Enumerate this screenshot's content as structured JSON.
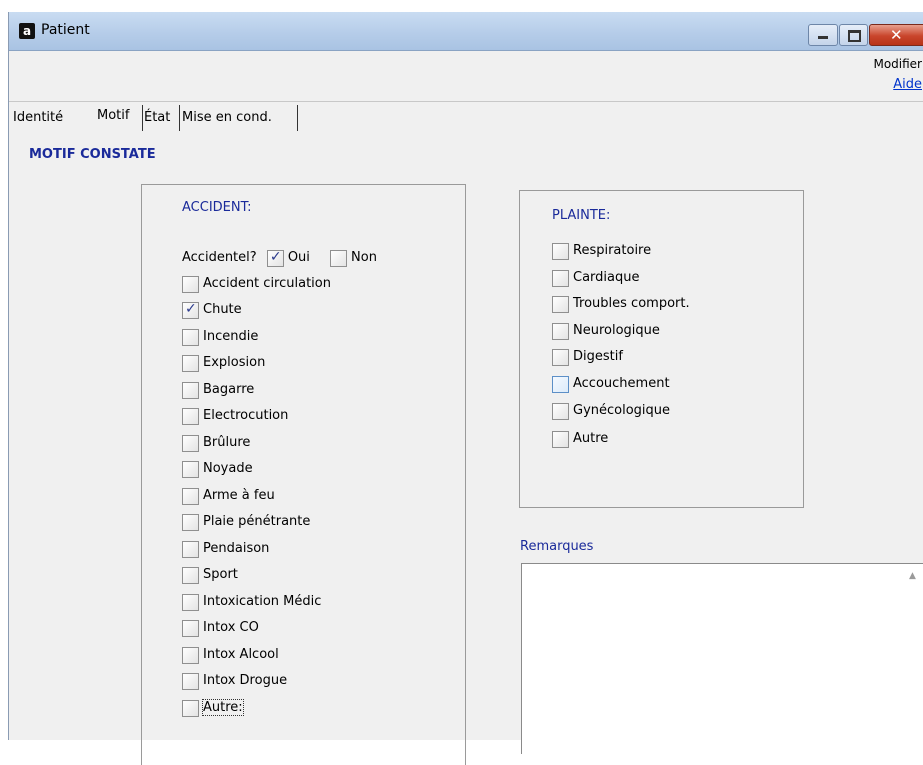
{
  "window": {
    "title": "Patient",
    "icon": "app-logo-icon"
  },
  "toolbar": {
    "modify": "Modifier",
    "help": "Aide"
  },
  "tabs": [
    "Identité",
    "Motif",
    "État",
    "Mise en cond."
  ],
  "section_title": "MOTIF CONSTATE",
  "accident": {
    "title": "ACCIDENT:",
    "accidental_label": "Accidentel?",
    "oui": "Oui",
    "non": "Non",
    "oui_checked": true,
    "non_checked": false,
    "items": [
      {
        "label": "Accident circulation",
        "checked": false
      },
      {
        "label": "Chute",
        "checked": true
      },
      {
        "label": "Incendie",
        "checked": false
      },
      {
        "label": "Explosion",
        "checked": false
      },
      {
        "label": "Bagarre",
        "checked": false
      },
      {
        "label": "Electrocution",
        "checked": false
      },
      {
        "label": "Brûlure",
        "checked": false
      },
      {
        "label": "Noyade",
        "checked": false
      },
      {
        "label": "Arme à feu",
        "checked": false
      },
      {
        "label": "Plaie pénétrante",
        "checked": false
      },
      {
        "label": "Pendaison",
        "checked": false
      },
      {
        "label": "Sport",
        "checked": false
      },
      {
        "label": "Intoxication Médic",
        "checked": false
      },
      {
        "label": "Intox CO",
        "checked": false
      },
      {
        "label": "Intox Alcool",
        "checked": false
      },
      {
        "label": "Intox Drogue",
        "checked": false
      },
      {
        "label": "Autre:",
        "checked": false
      }
    ]
  },
  "plainte": {
    "title": "PLAINTE:",
    "items": [
      {
        "label": "Respiratoire",
        "checked": false
      },
      {
        "label": "Cardiaque",
        "checked": false
      },
      {
        "label": "Troubles comport.",
        "checked": false
      },
      {
        "label": "Neurologique",
        "checked": false
      },
      {
        "label": "Digestif",
        "checked": false
      },
      {
        "label": "Accouchement",
        "checked": false
      },
      {
        "label": "Gynécologique",
        "checked": false
      },
      {
        "label": "Autre",
        "checked": false
      }
    ]
  },
  "remarks": {
    "label": "Remarques",
    "value": ""
  }
}
